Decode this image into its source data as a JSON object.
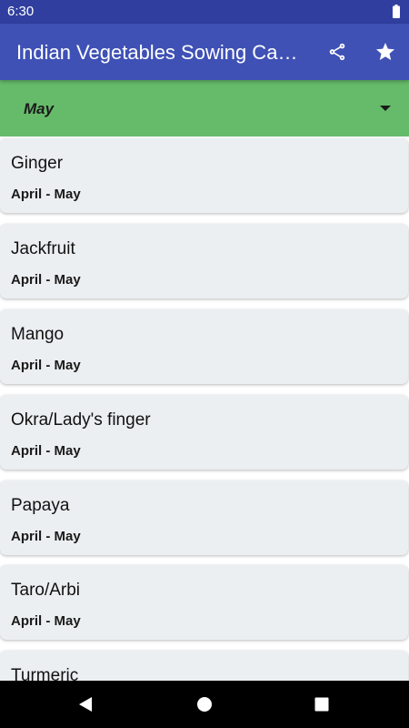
{
  "status_bar": {
    "time": "6:30",
    "icons": [
      "battery-icon"
    ]
  },
  "app_bar": {
    "title": "Indian Vegetables Sowing Calendar",
    "actions": [
      "share-icon",
      "star-icon"
    ]
  },
  "month_selector": {
    "selected": "May"
  },
  "crops": [
    {
      "name": "Ginger",
      "period": "April - May"
    },
    {
      "name": "Jackfruit",
      "period": "April - May"
    },
    {
      "name": "Mango",
      "period": "April - May"
    },
    {
      "name": "Okra/Lady's finger",
      "period": "April - May"
    },
    {
      "name": "Papaya",
      "period": "April - May"
    },
    {
      "name": "Taro/Arbi",
      "period": "April - May"
    },
    {
      "name": "Turmeric",
      "period": ""
    }
  ],
  "nav_bar": {
    "icons": [
      "back-icon",
      "home-icon",
      "recents-icon"
    ]
  },
  "colors": {
    "status_bar": "#303F9F",
    "app_bar": "#3F51B5",
    "month_selector": "#66BB6A",
    "card_background": "#ECEFF1",
    "nav_bar": "#000000"
  }
}
